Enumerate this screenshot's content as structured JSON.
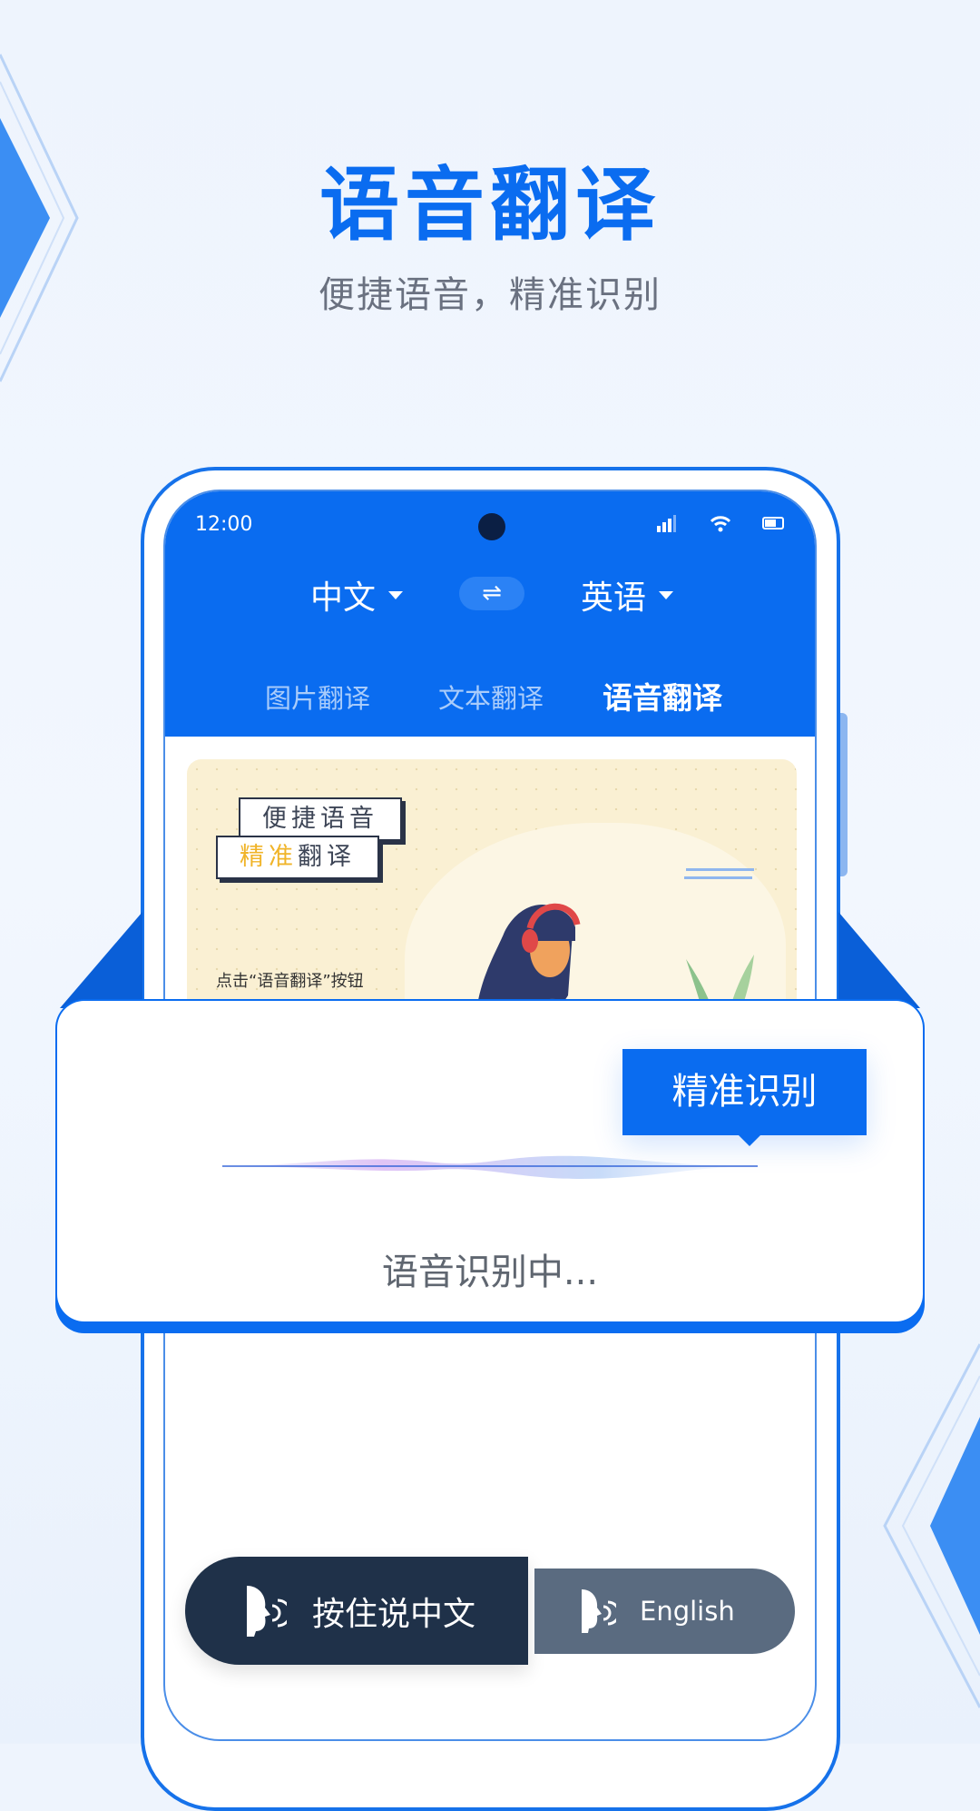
{
  "hero": {
    "title": "语音翻译",
    "subtitle": "便捷语音，精准识别"
  },
  "status_bar": {
    "time": "12:00",
    "icons": [
      "signal-icon",
      "wifi-icon",
      "battery-icon"
    ]
  },
  "language": {
    "source": "中文",
    "target": "英语",
    "swap_icon": "⇌"
  },
  "tabs": [
    {
      "label": "图片翻译",
      "active": false
    },
    {
      "label": "文本翻译",
      "active": false
    },
    {
      "label": "语音翻译",
      "active": true
    }
  ],
  "banner": {
    "tag1": "便捷语音",
    "tag2_highlight": "精准",
    "tag2_rest": "翻译",
    "caption": "点击“语音翻译”按钮"
  },
  "overlay": {
    "tooltip": "精准识别",
    "status": "语音识别中..."
  },
  "buttons": {
    "hold_zh": "按住说中文",
    "hold_en": "English"
  },
  "colors": {
    "accent": "#0a6cf0",
    "dark_button": "#1f3149",
    "light_button": "#5a6b80",
    "highlight": "#f0b429"
  }
}
